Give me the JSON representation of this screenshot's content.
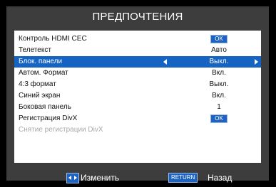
{
  "title": "ПРЕДПОЧТЕНИЯ",
  "items": [
    {
      "label": "Контроль HDMI CEC",
      "value": "OK",
      "kind": "button"
    },
    {
      "label": "Телетекст",
      "value": "Авто",
      "kind": "text"
    },
    {
      "label": "Блок. панели",
      "value": "Выкл.",
      "kind": "selector",
      "selected": true
    },
    {
      "label": "Автом. Формат",
      "value": "Вкл.",
      "kind": "text"
    },
    {
      "label": "4:3 формат",
      "value": "Выкл.",
      "kind": "text"
    },
    {
      "label": "Синий экран",
      "value": "Вкл.",
      "kind": "text"
    },
    {
      "label": "Боковая панель",
      "value": "1",
      "kind": "text"
    },
    {
      "label": "Регистрация DivX",
      "value": "OK",
      "kind": "button"
    },
    {
      "label": "Снятие регистрации DivX",
      "value": "",
      "kind": "disabled"
    }
  ],
  "footer": {
    "change_label": "Изменить",
    "return_key": "RETURN",
    "back_label": "Назад"
  },
  "colors": {
    "background": "#000000",
    "frame": "#3d3d3d",
    "menu": "#ffffff",
    "highlight": "#1564c4",
    "button": "#1f63c1",
    "disabled_text": "#a8a8a8"
  },
  "icons": [
    "arrow-left-icon",
    "arrow-right-icon",
    "left-right-nav-icon"
  ]
}
